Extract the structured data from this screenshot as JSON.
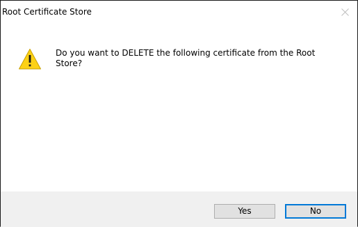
{
  "window": {
    "title": "Root Certificate Store",
    "close_icon": "close-icon"
  },
  "content": {
    "icon": "warning-icon",
    "message": "Do you want to DELETE the following certificate from the Root Store?"
  },
  "buttons": {
    "yes_label": "Yes",
    "no_label": "No"
  },
  "colors": {
    "warning_fill": "#fcd116",
    "focus_border": "#0078d7",
    "button_bar": "#f0f0f0"
  }
}
